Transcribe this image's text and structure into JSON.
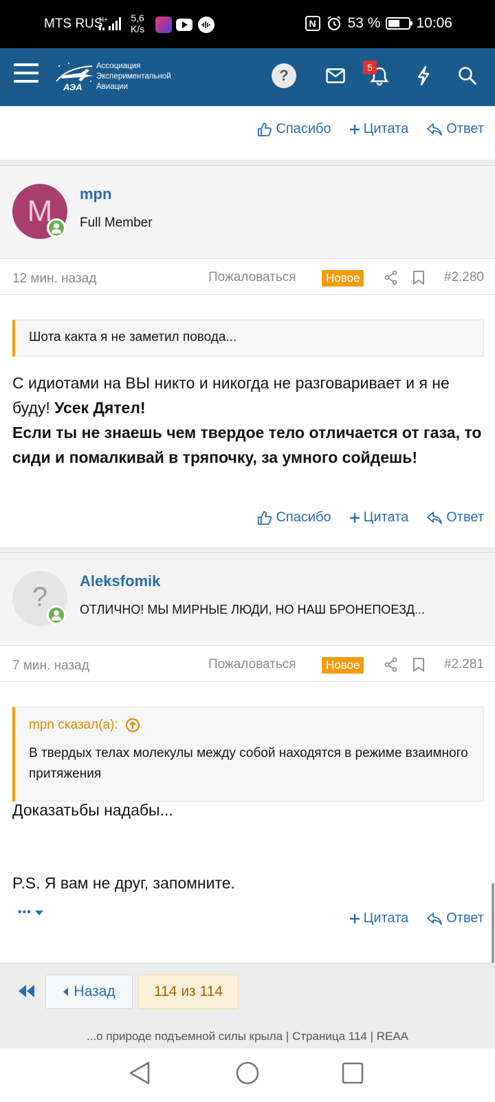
{
  "status_bar": {
    "carrier": "MTS RUS",
    "speed_value": "5,6",
    "speed_unit": "K/s",
    "battery": "53 %",
    "time": "10:06"
  },
  "header": {
    "logo_line1": "Ассоциация",
    "logo_line2": "Экспериментальной",
    "logo_line3": "Авиации",
    "logo_mark": "АЭА",
    "help_label": "?",
    "alerts_badge": "5"
  },
  "actions": {
    "thanks": "Спасибо",
    "quote": "Цитата",
    "reply": "Ответ"
  },
  "posts": [
    {
      "avatar_letter": "M",
      "username": "mpn",
      "user_title": "Full Member",
      "time": "12 мин. назад",
      "report": "Пожаловаться",
      "new_badge": "Новое",
      "number": "#2.280",
      "quote_text": "Шота какта я не заметил повода...",
      "text_plain": "С идиотами на ВЫ никто и никогда не разговаривает и я не буду! ",
      "text_bold1": "Усек Дятел!",
      "text_bold2": "Если ты не знаешь чем твердое тело отличается от газа, то сиди и помалкивай в тряпочку, за умного сойдешь!"
    },
    {
      "avatar_letter": "?",
      "username": "Aleksfomik",
      "user_title": "ОТЛИЧНО! МЫ МИРНЫЕ ЛЮДИ, НО НАШ БРОНЕПОЕЗД...",
      "time": "7 мин. назад",
      "report": "Пожаловаться",
      "new_badge": "Новое",
      "number": "#2.281",
      "quote_author": "mpn сказал(а):",
      "quote_text": "В твердых телах молекулы между собой находятся в режиме взаимного притяжения",
      "text_line1": "Доказатьбы надабы...",
      "text_line2": "P.S. Я вам не друг, запомните.",
      "more_label": "•••"
    }
  ],
  "pager": {
    "prev_label": "Назад",
    "current": "114 из 114"
  },
  "footer_title": "...о природе подъемной силы крыла | Страница 114 | REAA",
  "colors": {
    "header_bg": "#1b5a8c",
    "link": "#2a6bae",
    "accent_orange": "#f39c12",
    "online_green": "#6ab04c",
    "avatar_m": "#a83e6f"
  }
}
